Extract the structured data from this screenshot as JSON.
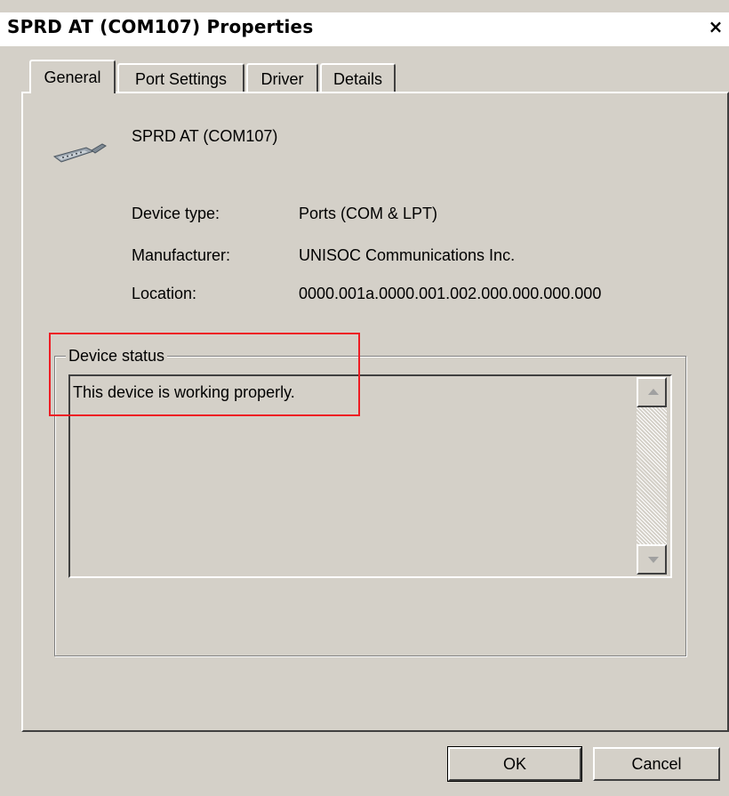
{
  "window": {
    "title": "SPRD AT (COM107) Properties",
    "close_label": "×"
  },
  "tabs": [
    {
      "label": "General",
      "active": true
    },
    {
      "label": "Port Settings",
      "active": false
    },
    {
      "label": "Driver",
      "active": false
    },
    {
      "label": "Details",
      "active": false
    }
  ],
  "device": {
    "icon": "serial-port-connector-icon",
    "name": "SPRD AT (COM107)"
  },
  "properties": [
    {
      "label": "Device type:",
      "value": "Ports (COM & LPT)"
    },
    {
      "label": "Manufacturer:",
      "value": "UNISOC Communications Inc."
    },
    {
      "label": "Location:",
      "value": "0000.001a.0000.001.002.000.000.000.000"
    }
  ],
  "device_status": {
    "legend": "Device status",
    "text": "This device is working properly."
  },
  "buttons": {
    "ok": "OK",
    "cancel": "Cancel"
  },
  "colors": {
    "face": "#d4d0c8",
    "highlight_box": "#ee1c24"
  }
}
